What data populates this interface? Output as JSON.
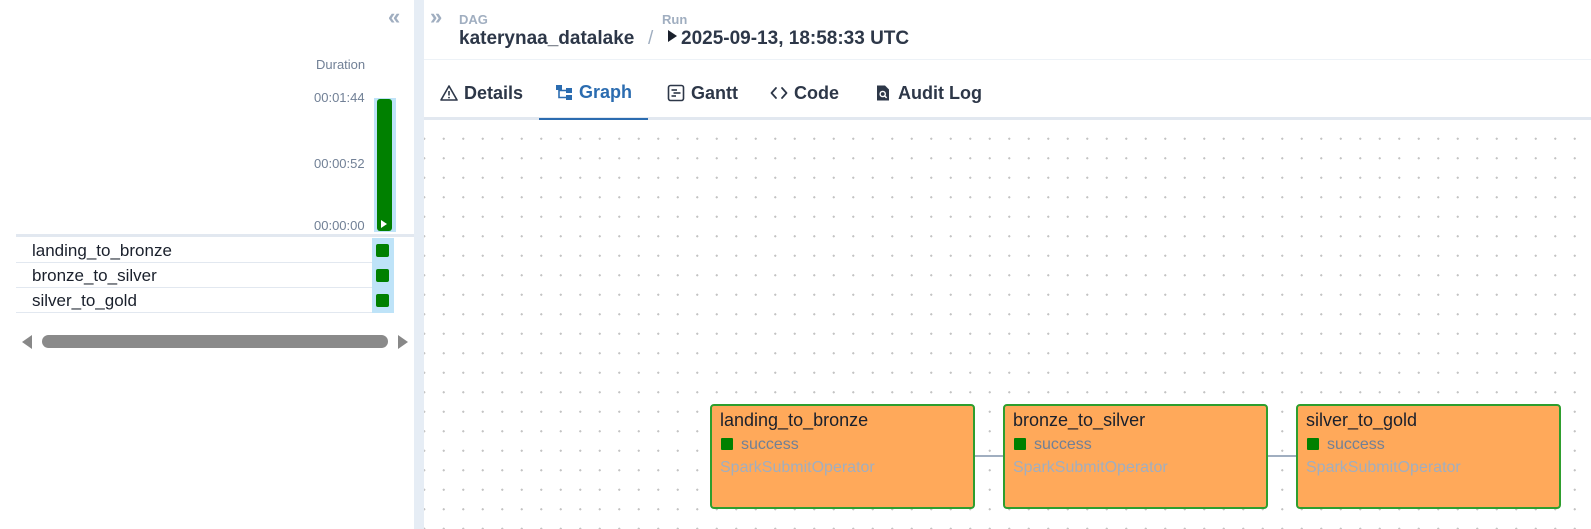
{
  "grid": {
    "duration_title": "Duration",
    "ticks": [
      "00:01:44",
      "00:00:52",
      "00:00:00"
    ],
    "run_duration_fraction": 1.0,
    "tasks": [
      {
        "name": "landing_to_bronze",
        "state": "success"
      },
      {
        "name": "bronze_to_silver",
        "state": "success"
      },
      {
        "name": "silver_to_gold",
        "state": "success"
      }
    ]
  },
  "breadcrumb": {
    "dag_label": "DAG",
    "dag_value": "katerynaa_datalake",
    "separator": "/",
    "run_label": "Run",
    "run_value": "2025-09-13, 18:58:33 UTC"
  },
  "tabs": [
    {
      "label": "Details",
      "icon": "warning-triangle-icon",
      "active": false
    },
    {
      "label": "Graph",
      "icon": "graph-icon",
      "active": true
    },
    {
      "label": "Gantt",
      "icon": "gantt-icon",
      "active": false
    },
    {
      "label": "Code",
      "icon": "code-icon",
      "active": false
    },
    {
      "label": "Audit Log",
      "icon": "audit-log-icon",
      "active": false
    }
  ],
  "graph": {
    "nodes": [
      {
        "name": "landing_to_bronze",
        "state": "success",
        "operator": "SparkSubmitOperator"
      },
      {
        "name": "bronze_to_silver",
        "state": "success",
        "operator": "SparkSubmitOperator"
      },
      {
        "name": "silver_to_gold",
        "state": "success",
        "operator": "SparkSubmitOperator"
      }
    ]
  },
  "colors": {
    "success": "#008000",
    "node_fill": "#ffa95a",
    "accent": "#2b6cb0"
  }
}
